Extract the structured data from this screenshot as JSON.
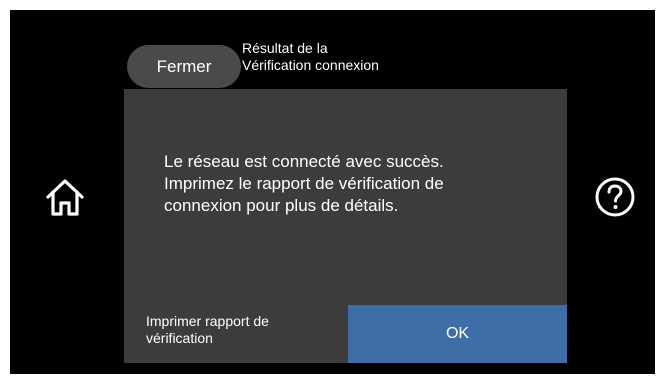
{
  "header": {
    "close_label": "Fermer",
    "title_line1": "Résultat de la",
    "title_line2": "Vérification connexion"
  },
  "dialog": {
    "message_line1": "Le réseau est connecté avec succès.",
    "message_line2": "Imprimez le rapport de vérification de",
    "message_line3": "connexion pour plus de détails.",
    "print_label_line1": "Imprimer rapport de",
    "print_label_line2": "vérification",
    "ok_label": "OK"
  },
  "icons": {
    "home": "home-icon",
    "help": "help-icon"
  },
  "colors": {
    "screen_background": "#000000",
    "dialog_background": "#3c3c3c",
    "close_button": "#4a4a4a",
    "ok_button": "#3f6da8",
    "text": "#ffffff"
  }
}
